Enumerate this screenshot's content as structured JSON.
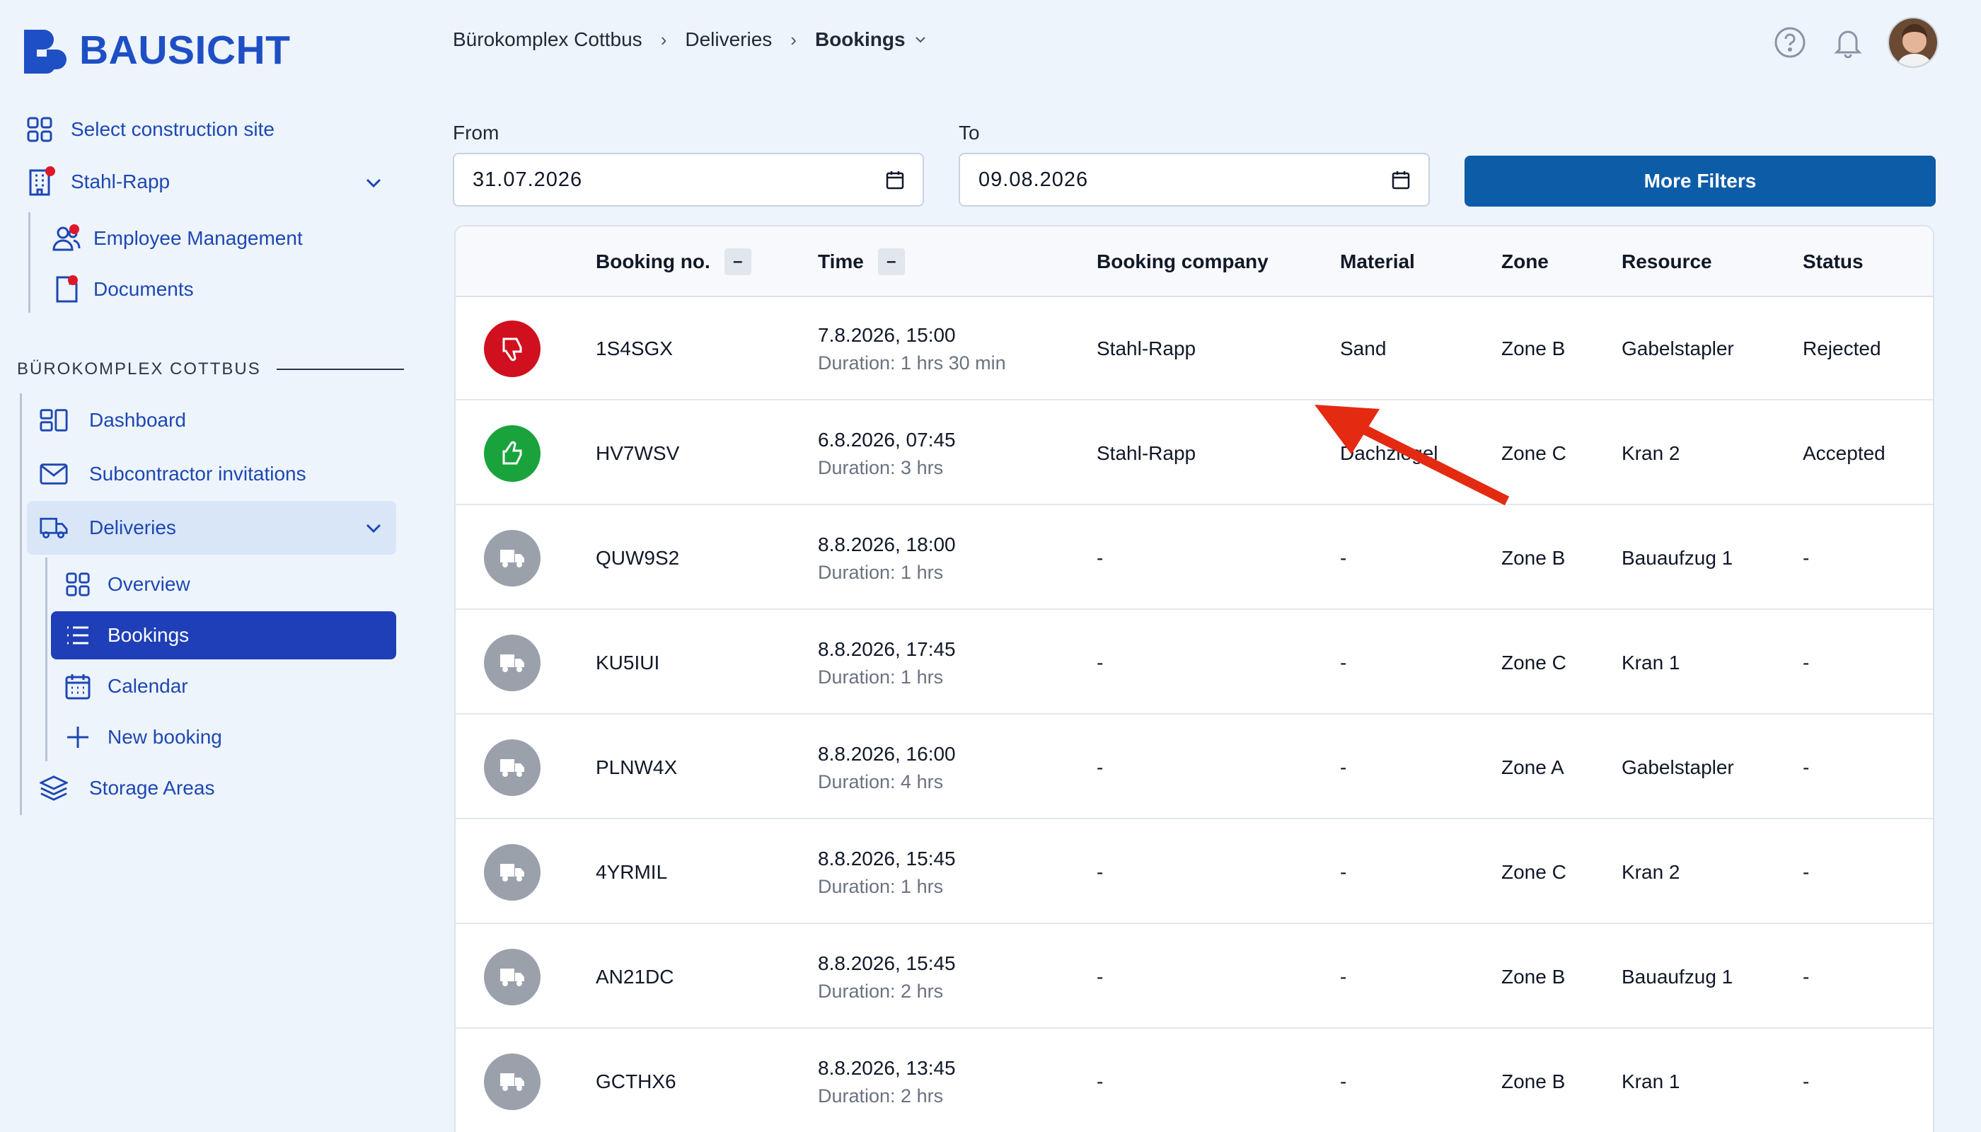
{
  "brand": {
    "name": "BAUSICHT",
    "color": "#1e4fc4"
  },
  "sidebar": {
    "select_site": "Select construction site",
    "company": "Stahl-Rapp",
    "company_items": [
      {
        "label": "Employee Management",
        "icon": "users-icon"
      },
      {
        "label": "Documents",
        "icon": "document-icon"
      }
    ],
    "section_title": "BÜROKOMPLEX COTTBUS",
    "items": [
      {
        "label": "Dashboard",
        "icon": "dashboard-icon"
      },
      {
        "label": "Subcontractor invitations",
        "icon": "mail-icon"
      },
      {
        "label": "Deliveries",
        "icon": "truck-icon"
      }
    ],
    "deliveries_sub": [
      {
        "label": "Overview",
        "icon": "grid-icon"
      },
      {
        "label": "Bookings",
        "icon": "list-icon"
      },
      {
        "label": "Calendar",
        "icon": "calendar-icon"
      },
      {
        "label": "New booking",
        "icon": "plus-icon"
      }
    ],
    "storage": {
      "label": "Storage Areas",
      "icon": "layers-icon"
    }
  },
  "breadcrumb": {
    "site": "Bürokomplex Cottbus",
    "section": "Deliveries",
    "current": "Bookings"
  },
  "filters": {
    "from_label": "From",
    "from_value": "31.07.2026",
    "to_label": "To",
    "to_value": "09.08.2026",
    "more_filters": "More Filters"
  },
  "table": {
    "headers": {
      "booking_no": "Booking no.",
      "time": "Time",
      "company": "Booking company",
      "material": "Material",
      "zone": "Zone",
      "resource": "Resource",
      "status": "Status"
    },
    "sort_symbol": "–",
    "rows": [
      {
        "state": "rejected",
        "no": "1S4SGX",
        "date": "7.8.2026, 15:00",
        "duration": "Duration: 1 hrs 30 min",
        "company": "Stahl-Rapp",
        "material": "Sand",
        "zone": "Zone B",
        "resource": "Gabelstapler",
        "status": "Rejected"
      },
      {
        "state": "accepted",
        "no": "HV7WSV",
        "date": "6.8.2026, 07:45",
        "duration": "Duration: 3 hrs",
        "company": "Stahl-Rapp",
        "material": "Dachziegel",
        "zone": "Zone C",
        "resource": "Kran 2",
        "status": "Accepted"
      },
      {
        "state": "pending",
        "no": "QUW9S2",
        "date": "8.8.2026, 18:00",
        "duration": "Duration: 1 hrs",
        "company": "-",
        "material": "-",
        "zone": "Zone B",
        "resource": "Bauaufzug 1",
        "status": "-"
      },
      {
        "state": "pending",
        "no": "KU5IUI",
        "date": "8.8.2026, 17:45",
        "duration": "Duration: 1 hrs",
        "company": "-",
        "material": "-",
        "zone": "Zone C",
        "resource": "Kran 1",
        "status": "-"
      },
      {
        "state": "pending",
        "no": "PLNW4X",
        "date": "8.8.2026, 16:00",
        "duration": "Duration: 4 hrs",
        "company": "-",
        "material": "-",
        "zone": "Zone A",
        "resource": "Gabelstapler",
        "status": "-"
      },
      {
        "state": "pending",
        "no": "4YRMIL",
        "date": "8.8.2026, 15:45",
        "duration": "Duration: 1 hrs",
        "company": "-",
        "material": "-",
        "zone": "Zone C",
        "resource": "Kran 2",
        "status": "-"
      },
      {
        "state": "pending",
        "no": "AN21DC",
        "date": "8.8.2026, 15:45",
        "duration": "Duration: 2 hrs",
        "company": "-",
        "material": "-",
        "zone": "Zone B",
        "resource": "Bauaufzug 1",
        "status": "-"
      },
      {
        "state": "pending",
        "no": "GCTHX6",
        "date": "8.8.2026, 13:45",
        "duration": "Duration: 2 hrs",
        "company": "-",
        "material": "-",
        "zone": "Zone B",
        "resource": "Kran 1",
        "status": "-"
      }
    ]
  },
  "colors": {
    "rejected": "#d0101e",
    "accepted": "#1aa33c",
    "pending": "#9aa1ab",
    "primary": "#0d5ca8",
    "annotation_arrow": "#e52a12"
  }
}
